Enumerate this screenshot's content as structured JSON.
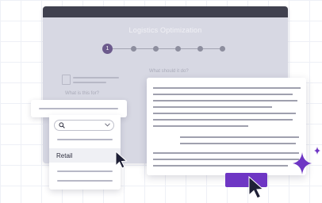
{
  "window": {
    "title": "Logistics Optimization",
    "steps": [
      {
        "label": "1"
      },
      {
        "label": ""
      },
      {
        "label": ""
      },
      {
        "label": ""
      },
      {
        "label": ""
      },
      {
        "label": ""
      }
    ]
  },
  "form": {
    "question_right": "What should it do?",
    "question_left": "What is this for?"
  },
  "dropdown": {
    "selected_option": "Retail",
    "search_icon": "search-icon",
    "chevron_icon": "chevron-down-icon"
  },
  "colors": {
    "accent": "#6e36c4",
    "window_bar": "#40414f",
    "step_active": "#6c5a8c",
    "sparkle": "#6e36c4"
  }
}
